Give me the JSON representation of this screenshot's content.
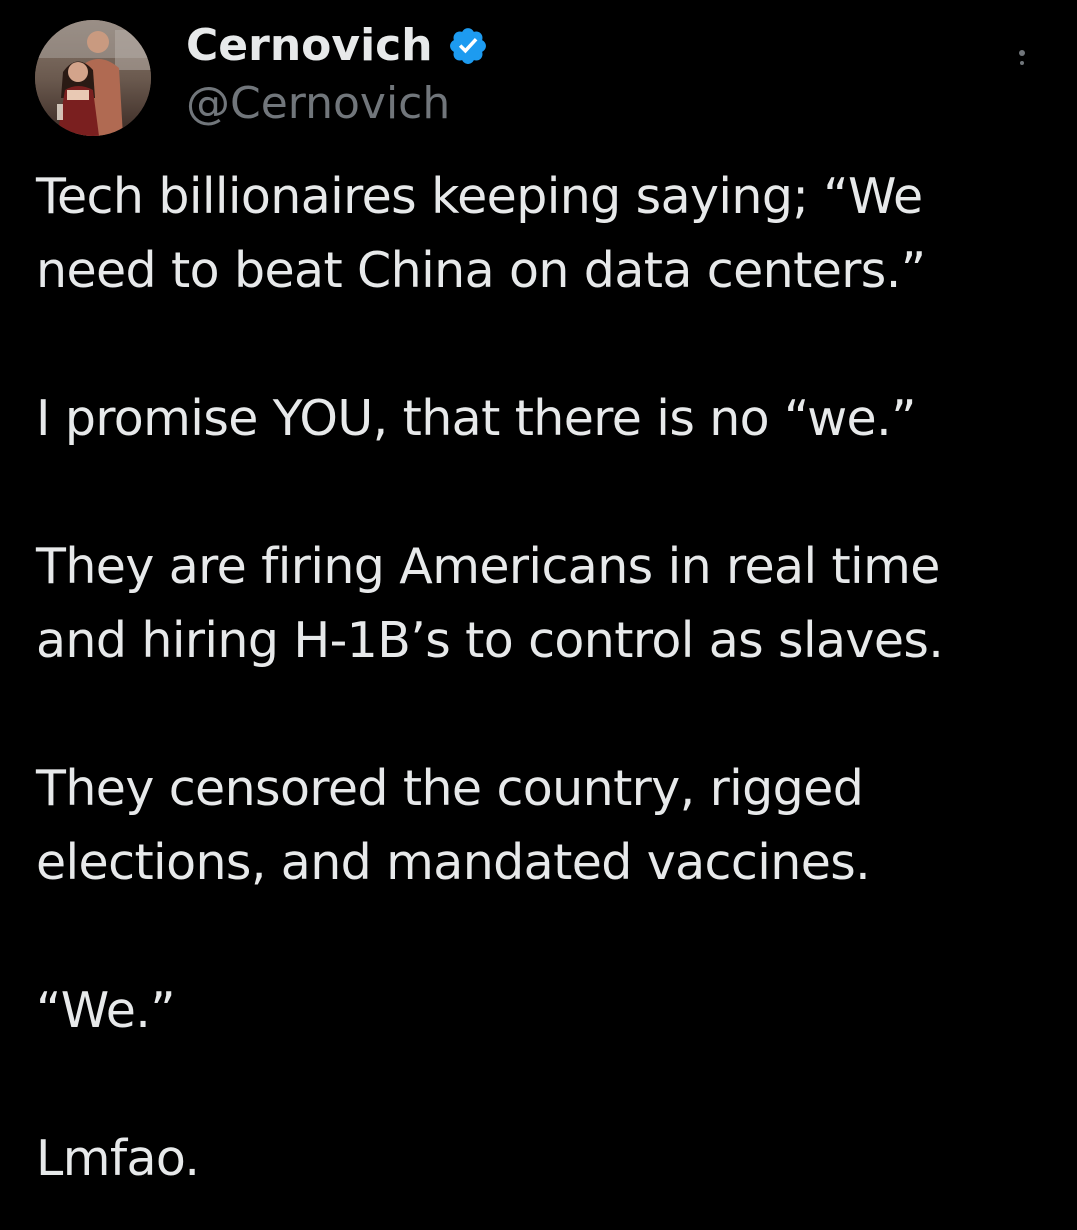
{
  "tweet": {
    "author": {
      "display_name": "Cernovich",
      "handle": "@Cernovich",
      "verified": true,
      "verified_icon": "verified-badge-icon",
      "avatar_icon": "profile-avatar"
    },
    "more_icon": "more-options-icon",
    "paragraphs": [
      {
        "lines": [
          "Tech billionaires keeping saying; “We",
          "need to beat China on data centers.”"
        ]
      },
      {
        "lines": [
          "I promise YOU, that there is no “we.”"
        ]
      },
      {
        "lines": [
          "They are firing Americans in real time",
          "and hiring H-1B’s to control as slaves."
        ]
      },
      {
        "lines": [
          "They censored the country, rigged",
          "elections, and mandated vaccines."
        ]
      },
      {
        "lines": [
          "“We.”"
        ]
      },
      {
        "lines": [
          "Lmfao."
        ]
      }
    ]
  },
  "colors": {
    "background": "#000000",
    "text_primary": "#e7e9ea",
    "text_secondary": "#71767b",
    "verified_blue": "#1d9bf0"
  }
}
